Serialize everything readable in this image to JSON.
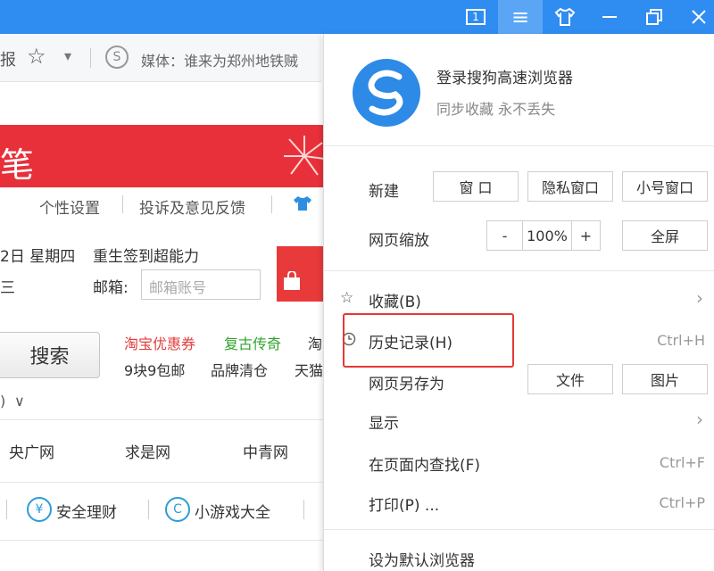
{
  "titlebar": {
    "buttons": [
      {
        "name": "tab-count-icon",
        "glyph": "1"
      },
      {
        "name": "menu-icon",
        "glyph": "≡"
      },
      {
        "name": "skin-icon",
        "glyph": "👕"
      },
      {
        "name": "minimize-icon",
        "glyph": "—"
      },
      {
        "name": "restore-icon",
        "glyph": "❐"
      },
      {
        "name": "close-icon",
        "glyph": "✕"
      }
    ]
  },
  "toolbar": {
    "cut_char": "报",
    "star": "☆",
    "dropdown": "▾",
    "logo_letter": "S",
    "news_text": "媒体：谁来为郑州地铁贼"
  },
  "page": {
    "banner_char": "笔",
    "links": [
      "个性设置",
      "投诉及意见反馈"
    ],
    "date": "2日 星期四",
    "weekday_cut": "三",
    "signin": "重生签到超能力",
    "email_label": "邮箱:",
    "email_placeholder": "邮箱账号",
    "search_button": "搜索",
    "promo": [
      {
        "text": "淘宝优惠券",
        "color": "red"
      },
      {
        "text": "复古传奇",
        "color": "green"
      },
      {
        "text": "淘",
        "color": "gray"
      }
    ],
    "promo2": [
      "9块9包邮",
      "品牌清仓",
      "天猫"
    ],
    "paren_cut": ")",
    "chevron": "∨",
    "sites": [
      "央广网",
      "求是网",
      "中青网"
    ],
    "services": [
      {
        "icon": "¥",
        "label": "安全理财"
      },
      {
        "icon": "C",
        "label": "小游戏大全"
      }
    ]
  },
  "menu": {
    "login_title": "登录搜狗高速浏览器",
    "login_sub": "同步收藏 永不丢失",
    "new_label": "新建",
    "new_buttons": [
      "窗 口",
      "隐私窗口",
      "小号窗口"
    ],
    "zoom_label": "网页缩放",
    "zoom_minus": "-",
    "zoom_value": "100%",
    "zoom_plus": "+",
    "fullscreen": "全屏",
    "favorites": "收藏(B)",
    "history": "历史记录(H)",
    "history_shortcut": "Ctrl+H",
    "saveas": "网页另存为",
    "saveas_buttons": [
      "文件",
      "图片"
    ],
    "display": "显示",
    "find": "在页面内查找(F)",
    "find_shortcut": "Ctrl+F",
    "print": "打印(P) ...",
    "print_shortcut": "Ctrl+P",
    "default_browser": "设为默认浏览器"
  },
  "colors": {
    "titlebar": "#2f8cf0",
    "banner": "#e8303a",
    "highlight": "#e53935",
    "logo": "#2d8ae6"
  }
}
